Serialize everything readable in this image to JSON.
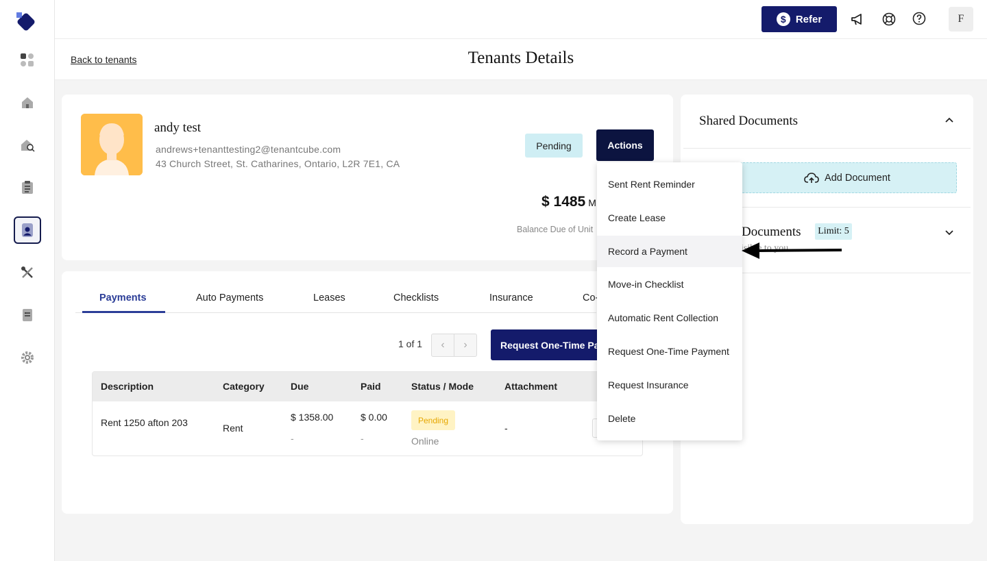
{
  "topbar": {
    "refer_label": "Refer",
    "refer_icon": "dollar-icon",
    "icons": [
      "megaphone-icon",
      "lifebuoy-icon",
      "help-icon"
    ],
    "user_initial": "F"
  },
  "sidebar": {
    "items": [
      {
        "name": "dashboard",
        "icon": "grid-icon"
      },
      {
        "name": "properties",
        "icon": "home-icon"
      },
      {
        "name": "listings",
        "icon": "home-search-icon"
      },
      {
        "name": "applications",
        "icon": "clipboard-icon"
      },
      {
        "name": "tenants",
        "icon": "tenant-icon",
        "active": true
      },
      {
        "name": "maintenance",
        "icon": "tools-icon"
      },
      {
        "name": "accounting",
        "icon": "ledger-icon"
      },
      {
        "name": "settings",
        "icon": "gear-icon"
      }
    ]
  },
  "subheader": {
    "back_label": "Back to tenants",
    "title": "Tenants Details"
  },
  "tenant": {
    "name": "andy test",
    "email": "andrews+tenanttesting2@tenantcube.com",
    "address": "43 Church Street, St. Catharines, Ontario, L2R 7E1, CA",
    "status": "Pending",
    "actions_label": "Actions",
    "balance": "$ 1485",
    "balance_tail": "M",
    "balance_label": "Balance Due of Unit"
  },
  "tabs": [
    "Payments",
    "Auto Payments",
    "Leases",
    "Checklists",
    "Insurance",
    "Co-"
  ],
  "pager": {
    "text": "1 of 1",
    "prev": "‹",
    "next": "›"
  },
  "request_button_label": "Request One-Time Payment",
  "table": {
    "headers": [
      "Description",
      "Category",
      "Due",
      "Paid",
      "Status / Mode",
      "Attachment"
    ],
    "rows": [
      {
        "description": "Rent 1250 afton 203",
        "category": "Rent",
        "due": "$ 1358.00",
        "due_sub": "-",
        "paid": "$ 0.00",
        "paid_sub": "-",
        "status": "Pending",
        "mode": "Online",
        "attachment": "-"
      }
    ]
  },
  "documents": {
    "shared_title": "Shared Documents",
    "add_label": "Add Document",
    "my_title": "Documents",
    "limit_label": "Limit: 5",
    "my_subtext": "isible to you"
  },
  "actions_menu": {
    "items": [
      "Sent Rent Reminder",
      "Create Lease",
      "Record a Payment",
      "Move-in Checklist",
      "Automatic Rent Collection",
      "Request One-Time Payment",
      "Request Insurance",
      "Delete"
    ],
    "highlighted_index": 2
  },
  "colors": {
    "brand_navy": "#141b6b",
    "actions_navy": "#0c1440",
    "accent_blue": "#2b3d97",
    "pending_badge": "#cfeef4",
    "pending_pill": "#fff3c4",
    "avatar_bg": "#ffbd4a"
  }
}
